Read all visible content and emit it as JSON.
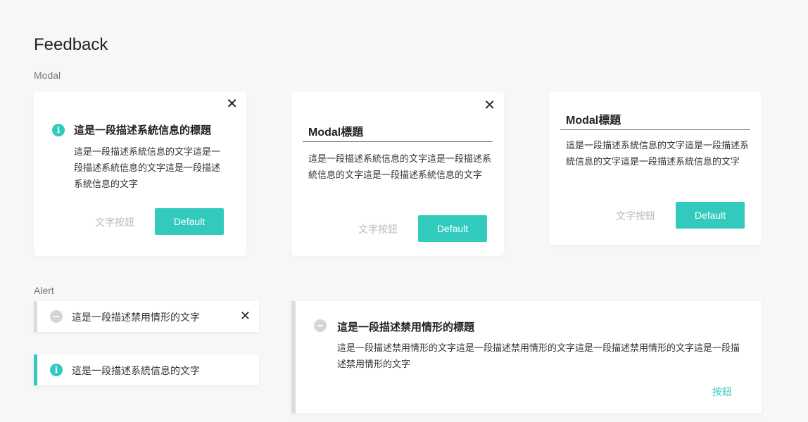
{
  "page": {
    "title": "Feedback"
  },
  "sections": {
    "modal_label": "Modal",
    "alert_label": "Alert"
  },
  "theme": {
    "accent": "#32cabd",
    "muted_text": "#bbbbbb",
    "disabled_icon": "#d5d5d5"
  },
  "modals": {
    "info": {
      "icon": "info-icon",
      "close_glyph": "✕",
      "title": "這是一段描述系統信息的標題",
      "body": "這是一段描述系統信息的文字這是一段描述系統信息的文字這是一段描述系統信息的文字",
      "text_button": "文字按鈕",
      "primary_button": "Default"
    },
    "with_close": {
      "close_glyph": "✕",
      "title": "Modal標題",
      "body": "這是一段描述系統信息的文字這是一段描述系統信息的文字這是一段描述系統信息的文字",
      "text_button": "文字按鈕",
      "primary_button": "Default"
    },
    "plain": {
      "title": "Modal標題",
      "body": "這是一段描述系統信息的文字這是一段描述系統信息的文字這是一段描述系統信息的文字",
      "text_button": "文字按鈕",
      "primary_button": "Default"
    }
  },
  "alerts": {
    "disabled_closable": {
      "icon": "minus-circle-icon",
      "text": "這是一段描述禁用情形的文字",
      "close_glyph": "✕"
    },
    "info": {
      "icon": "info-icon",
      "text": "這是一段描述系統信息的文字"
    },
    "disabled_detailed": {
      "icon": "minus-circle-icon",
      "title": "這是一段描述禁用情形的標題",
      "body": "這是一段描述禁用情形的文字這是一段描述禁用情形的文字這是一段描述禁用情形的文字這是一段描述禁用情形的文字",
      "link_button": "按鈕"
    }
  }
}
